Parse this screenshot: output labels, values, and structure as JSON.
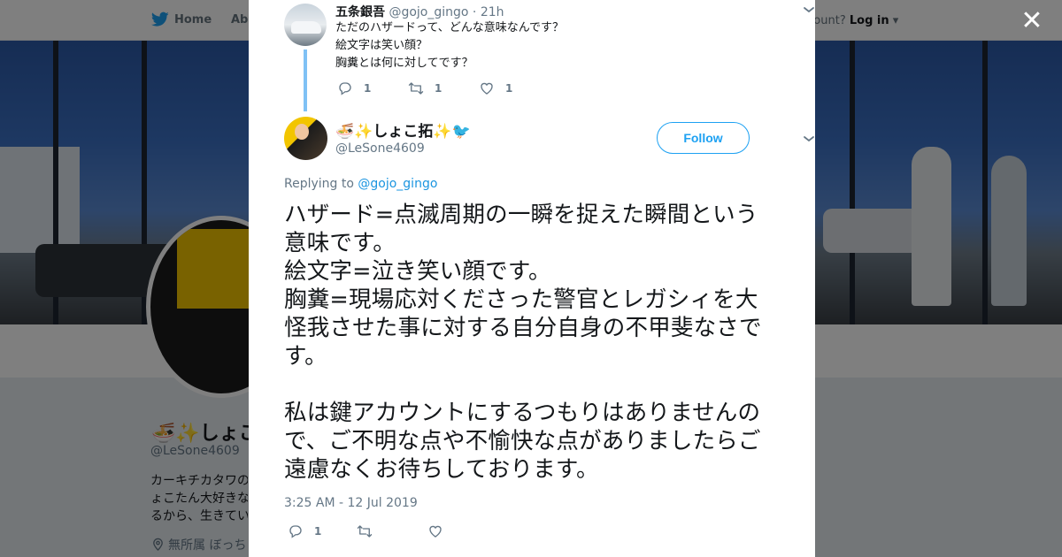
{
  "background": {
    "nav": {
      "home_label": "Home",
      "about_label": "Abo",
      "account_prompt": "ccount?",
      "login_label": "Log in"
    },
    "profile": {
      "display_name": "🍜✨しょこ",
      "handle": "@LeSone4609",
      "bio": "カーキチカタワの\nょこたん大好きな\nるから、生きてい",
      "location": "無所属 ぼっち"
    }
  },
  "modal": {
    "close_label": "✕",
    "parent_tweet": {
      "name": "五条銀吾",
      "handle": "@gojo_gingo",
      "time": "· 21h",
      "text": "ただのハザードって、どんな意味なんです？\n絵文字は笑い顔？\n胸糞とは何に対してです？",
      "reply_count": "1",
      "retweet_count": "1",
      "like_count": "1"
    },
    "tweet": {
      "author_name": "🍜✨しょこ拓✨🐦",
      "author_handle": "@LeSone4609",
      "follow_label": "Follow",
      "replying_prefix": "Replying to ",
      "replying_to": "@gojo_gingo",
      "text": "ハザード=点滅周期の一瞬を捉えた瞬間という意味です。\n絵文字=泣き笑い顔です。\n胸糞=現場応対くださった警官とレガシィを大怪我させた事に対する自分自身の不甲斐なさです。\n\n私は鍵アカウントにするつもりはありませんので、ご不明な点や不愉快な点がありましたらご遠慮なくお待ちしております。",
      "timestamp": "3:25 AM - 12 Jul 2019",
      "reply_count": "1",
      "retweet_count": "",
      "like_count": ""
    }
  },
  "colors": {
    "accent": "#1da1f2",
    "link": "#1b95e0",
    "muted": "#657786",
    "text": "#14171a",
    "thread": "#7fc1f5"
  },
  "icons": [
    "twitter-bird-icon",
    "close-icon",
    "chevron-down-icon",
    "reply-icon",
    "retweet-icon",
    "heart-icon",
    "location-pin-icon"
  ]
}
